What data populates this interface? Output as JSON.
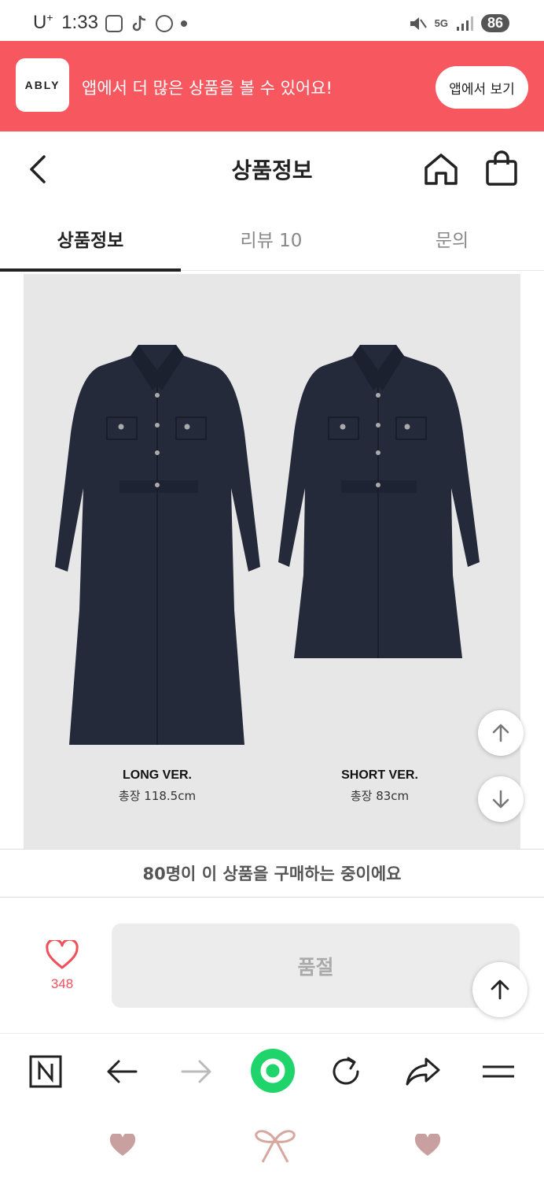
{
  "status_bar": {
    "carrier": "U",
    "carrier_sup": "+",
    "time": "1:33",
    "network": "5G",
    "battery": "86"
  },
  "app_banner": {
    "logo_text": "ABLY",
    "message": "앱에서 더 많은 상품을 볼 수 있어요!",
    "button_label": "앱에서 보기",
    "bg_color": "#f7575f"
  },
  "header": {
    "title": "상품정보",
    "icons": [
      "back-icon",
      "home-icon",
      "shopping-bag-icon"
    ]
  },
  "tabs": [
    {
      "label": "상품정보",
      "active": true
    },
    {
      "label": "리뷰 10",
      "active": false
    },
    {
      "label": "문의",
      "active": false
    }
  ],
  "product": {
    "variants": [
      {
        "name": "LONG VER.",
        "length": "총장 118.5cm"
      },
      {
        "name": "SHORT VER.",
        "length": "총장 83cm"
      }
    ]
  },
  "buyers_notice": "80명이 이 상품을 구매하는 중이에요",
  "action_bar": {
    "like_count": "348",
    "sold_out_label": "품절",
    "accent_color": "#f0505a"
  },
  "browser_bar": {
    "icons": [
      "naver-icon",
      "back-arrow-icon",
      "forward-arrow-icon",
      "green-dot-icon",
      "refresh-icon",
      "share-icon",
      "menu-icon"
    ]
  },
  "nav_bar": {
    "icons": [
      "heart-icon",
      "ribbon-icon",
      "heart-icon"
    ]
  }
}
